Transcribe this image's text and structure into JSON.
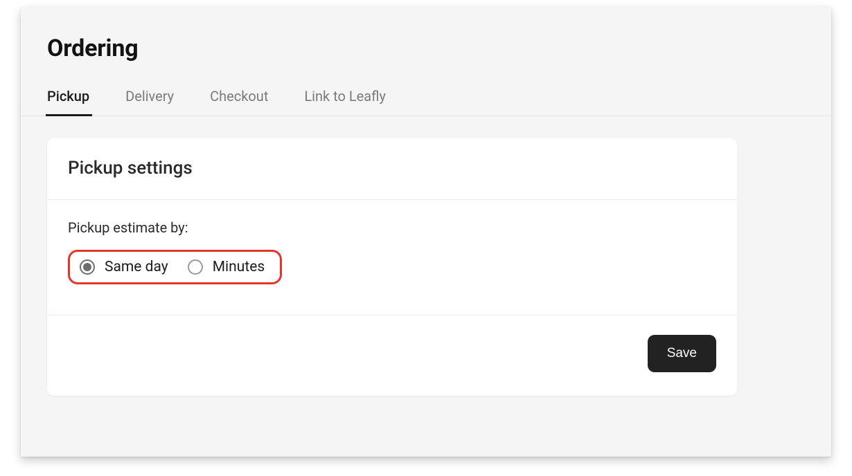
{
  "page": {
    "title": "Ordering"
  },
  "tabs": [
    {
      "label": "Pickup",
      "active": true
    },
    {
      "label": "Delivery",
      "active": false
    },
    {
      "label": "Checkout",
      "active": false
    },
    {
      "label": "Link to Leafly",
      "active": false
    }
  ],
  "card": {
    "header": "Pickup settings",
    "estimate_label": "Pickup estimate by:",
    "estimate_options": [
      {
        "label": "Same day",
        "selected": true
      },
      {
        "label": "Minutes",
        "selected": false
      }
    ],
    "save_label": "Save"
  }
}
